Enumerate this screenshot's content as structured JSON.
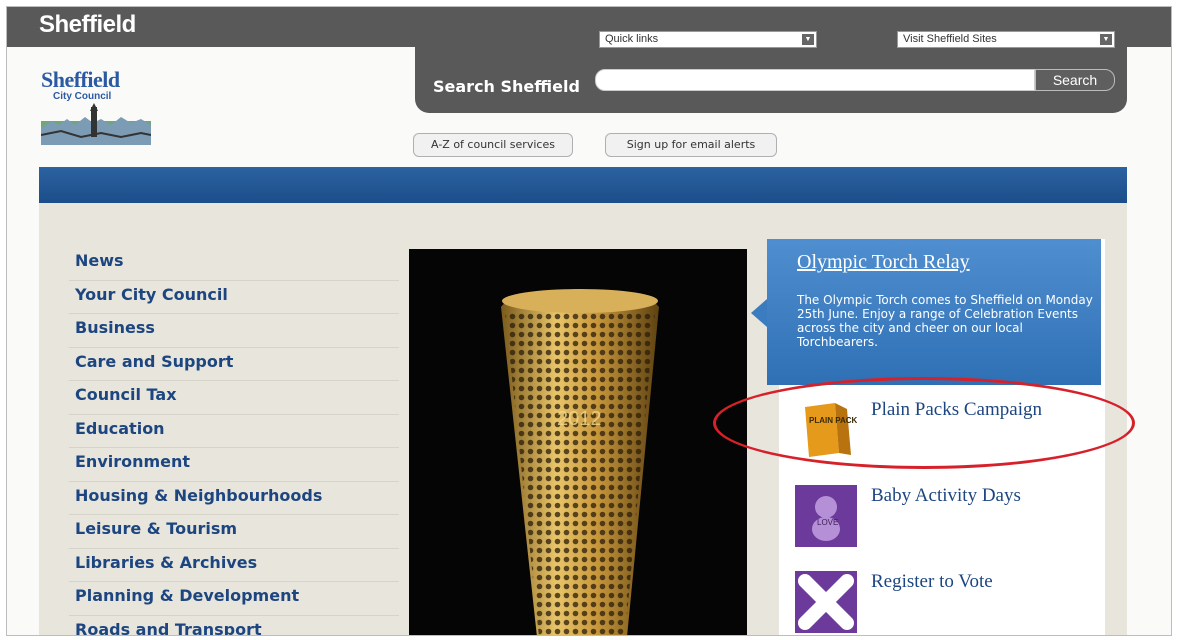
{
  "header": {
    "site_name": "Sheffield",
    "quick_links_select": "Quick links",
    "visit_sites_select": "Visit Sheffield Sites",
    "search_label": "Search Sheffield",
    "search_placeholder": "",
    "search_button": "Search"
  },
  "logo": {
    "name": "Sheffield",
    "subtitle": "City Council"
  },
  "top_buttons": {
    "az": "A-Z of council services",
    "email_alerts": "Sign up for email alerts"
  },
  "nav": {
    "items": [
      "News",
      "Your City Council",
      "Business",
      "Care and Support",
      "Council Tax",
      "Education",
      "Environment",
      "Housing & Neighbourhoods",
      "Leisure & Tourism",
      "Libraries & Archives",
      "Planning & Development",
      "Roads and Transport"
    ]
  },
  "feature": {
    "title": "Olympic Torch Relay",
    "text": "The Olympic Torch comes to Sheffield on Monday 25th June. Enjoy a range of Celebration Events across the city and cheer on our local Torchbearers."
  },
  "promos": [
    {
      "title": "Plain Packs Campaign",
      "thumb_text": "PLAIN PACKS"
    },
    {
      "title": "Baby Activity Days",
      "thumb_text": "LOVE"
    },
    {
      "title": "Register to Vote",
      "thumb_text": ""
    }
  ],
  "colors": {
    "header_gray": "#595959",
    "nav_blue": "#1d4680",
    "band_blue": "#1b4e8b",
    "content_bg": "#e8e6dc",
    "callout_blue": "#3b7cc0",
    "highlight_red": "#d6212a"
  }
}
